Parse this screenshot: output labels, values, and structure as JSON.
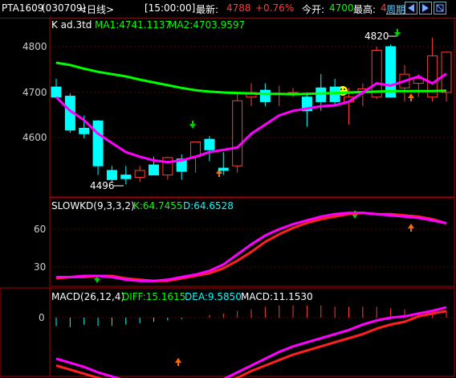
{
  "header": {
    "symbol": "PTA1609",
    "code": "(030709)",
    "period": "<日线>",
    "time": "[15:00:00]",
    "latest_label": "最新:",
    "latest_value": "4788",
    "change": "+0.76%",
    "open_label": "今开:",
    "open_value": "4700",
    "high_label": "最高:",
    "high_value": "4",
    "week_button": "周期"
  },
  "panel_k": {
    "title": "K ad.3td",
    "ma1": "MA1:4741.1137",
    "ma2": "MA2:4703.9597",
    "y_ticks": [
      "4800",
      "4700",
      "4600"
    ],
    "high_label": "4820",
    "low_label": "4496",
    "colors": {
      "up": "#ff3b3b",
      "down": "#00ffff",
      "ma1": "#ff00ff",
      "ma2": "#00ff00"
    }
  },
  "panel_kd": {
    "title": "SLOWKD(9,3,3,2)",
    "k": "K:64.7455",
    "d": "D:64.6528",
    "y_ticks": [
      "60",
      "30"
    ]
  },
  "panel_macd": {
    "title": "MACD(26,12,4)",
    "diff": "DIFF:15.1615",
    "dea": "DEA:9.5850",
    "macd": "MACD:11.1530",
    "y_ticks": [
      "0"
    ]
  },
  "chart_data": [
    {
      "type": "candlestick",
      "title": "K ad.3td",
      "ylim": [
        4470,
        4840
      ],
      "grid": true,
      "candles": [
        {
          "o": 4712,
          "h": 4730,
          "l": 4688,
          "c": 4690
        },
        {
          "o": 4692,
          "h": 4698,
          "l": 4612,
          "c": 4618
        },
        {
          "o": 4622,
          "h": 4650,
          "l": 4600,
          "c": 4610
        },
        {
          "o": 4638,
          "h": 4640,
          "l": 4520,
          "c": 4540
        },
        {
          "o": 4530,
          "h": 4540,
          "l": 4505,
          "c": 4510
        },
        {
          "o": 4520,
          "h": 4540,
          "l": 4500,
          "c": 4512
        },
        {
          "o": 4515,
          "h": 4540,
          "l": 4505,
          "c": 4530
        },
        {
          "o": 4542,
          "h": 4560,
          "l": 4520,
          "c": 4520
        },
        {
          "o": 4520,
          "h": 4560,
          "l": 4510,
          "c": 4558
        },
        {
          "o": 4555,
          "h": 4565,
          "l": 4510,
          "c": 4528
        },
        {
          "o": 4560,
          "h": 4590,
          "l": 4525,
          "c": 4592
        },
        {
          "o": 4598,
          "h": 4605,
          "l": 4550,
          "c": 4575
        },
        {
          "o": 4535,
          "h": 4570,
          "l": 4520,
          "c": 4530
        },
        {
          "o": 4540,
          "h": 4700,
          "l": 4525,
          "c": 4682
        },
        {
          "o": 4690,
          "h": 4720,
          "l": 4670,
          "c": 4700
        },
        {
          "o": 4705,
          "h": 4720,
          "l": 4670,
          "c": 4680
        },
        {
          "o": 4695,
          "h": 4715,
          "l": 4670,
          "c": 4698
        },
        {
          "o": 4700,
          "h": 4710,
          "l": 4690,
          "c": 4700
        },
        {
          "o": 4690,
          "h": 4700,
          "l": 4625,
          "c": 4660
        },
        {
          "o": 4710,
          "h": 4740,
          "l": 4660,
          "c": 4680
        },
        {
          "o": 4712,
          "h": 4730,
          "l": 4670,
          "c": 4680
        },
        {
          "o": 4680,
          "h": 4710,
          "l": 4630,
          "c": 4690
        },
        {
          "o": 4700,
          "h": 4720,
          "l": 4670,
          "c": 4708
        },
        {
          "o": 4690,
          "h": 4800,
          "l": 4685,
          "c": 4792
        },
        {
          "o": 4800,
          "h": 4805,
          "l": 4690,
          "c": 4690
        },
        {
          "o": 4710,
          "h": 4760,
          "l": 4680,
          "c": 4740
        },
        {
          "o": 4720,
          "h": 4740,
          "l": 4690,
          "c": 4730
        },
        {
          "o": 4690,
          "h": 4820,
          "l": 4680,
          "c": 4780
        },
        {
          "o": 4700,
          "h": 4790,
          "l": 4680,
          "c": 4788
        }
      ],
      "ma1": [
        4690,
        4660,
        4640,
        4610,
        4590,
        4570,
        4560,
        4552,
        4548,
        4552,
        4560,
        4570,
        4575,
        4580,
        4610,
        4630,
        4650,
        4660,
        4665,
        4670,
        4672,
        4680,
        4700,
        4720,
        4715,
        4725,
        4735,
        4720,
        4741
      ],
      "ma2": [
        4765,
        4760,
        4752,
        4745,
        4740,
        4735,
        4728,
        4722,
        4716,
        4710,
        4705,
        4702,
        4700,
        4699,
        4698,
        4697,
        4697,
        4696,
        4697,
        4698,
        4699,
        4700,
        4701,
        4702,
        4703,
        4703,
        4703,
        4703,
        4704
      ]
    },
    {
      "type": "line",
      "title": "SLOWKD(9,3,3,2)",
      "ylim": [
        5,
        80
      ],
      "series": [
        {
          "name": "K",
          "values": [
            22,
            22,
            23,
            23,
            22,
            20,
            19,
            19,
            20,
            22,
            24,
            27,
            32,
            40,
            48,
            55,
            60,
            64,
            67,
            70,
            72,
            73,
            73,
            72,
            71,
            70,
            69,
            67,
            64.7
          ]
        },
        {
          "name": "D",
          "values": [
            21,
            22,
            22,
            23,
            23,
            21,
            20,
            19,
            19,
            21,
            23,
            25,
            29,
            35,
            42,
            50,
            56,
            61,
            65,
            68,
            70,
            72,
            73,
            72,
            72,
            71,
            70,
            68,
            64.7
          ]
        }
      ]
    },
    {
      "type": "line",
      "title": "MACD(26,12,4)",
      "ylim": [
        -120,
        20
      ],
      "series": [
        {
          "name": "DIFF",
          "values": [
            -60,
            -66,
            -72,
            -80,
            -86,
            -92,
            -96,
            -100,
            -100,
            -98,
            -96,
            -93,
            -90,
            -80,
            -70,
            -60,
            -50,
            -42,
            -36,
            -30,
            -24,
            -18,
            -10,
            -4,
            0,
            2,
            6,
            10,
            15.2
          ]
        },
        {
          "name": "DEA",
          "values": [
            -70,
            -76,
            -82,
            -88,
            -94,
            -98,
            -102,
            -104,
            -104,
            -102,
            -100,
            -98,
            -96,
            -88,
            -78,
            -70,
            -62,
            -54,
            -48,
            -42,
            -36,
            -30,
            -24,
            -16,
            -10,
            -6,
            2,
            6,
            9.6
          ]
        },
        {
          "name": "MACD",
          "values": [
            -12,
            -14,
            -10,
            -12,
            -12,
            -10,
            -8,
            -6,
            -4,
            -2,
            0,
            4,
            6,
            10,
            12,
            16,
            18,
            18,
            18,
            18,
            16,
            16,
            16,
            16,
            14,
            12,
            8,
            8,
            11.2
          ]
        }
      ]
    }
  ]
}
